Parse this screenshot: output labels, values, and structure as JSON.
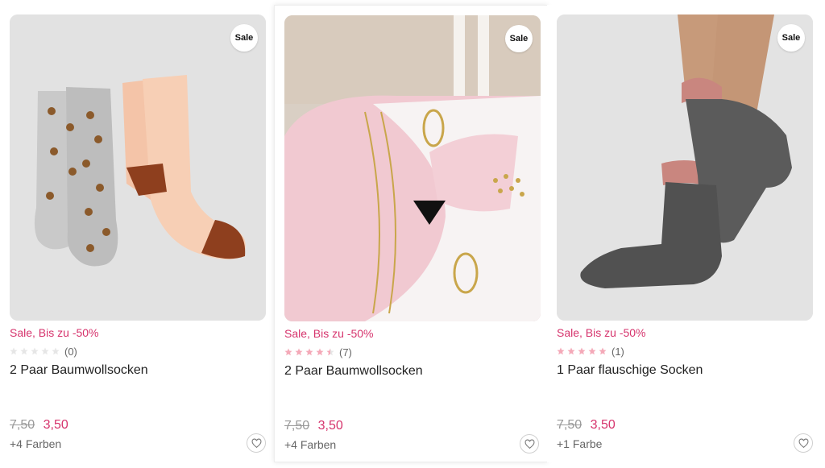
{
  "colors": {
    "accent": "#d6336c",
    "star_fill": "#f4a9b8",
    "star_empty": "#e6e6e6",
    "old_price": "#999999",
    "meta_text": "#666666"
  },
  "products": [
    {
      "sale_badge": "Sale",
      "promo": "Sale, Bis zu -50%",
      "rating": 0,
      "rating_count": "(0)",
      "title": "2 Paar Baumwollsocken",
      "old_price": "7,50",
      "new_price": "3,50",
      "colors": "+4 Farben",
      "wishlist_icon": "heart-icon"
    },
    {
      "sale_badge": "Sale",
      "promo": "Sale, Bis zu -50%",
      "rating": 4.5,
      "rating_count": "(7)",
      "title": "2 Paar Baumwollsocken",
      "old_price": "7,50",
      "new_price": "3,50",
      "colors": "+4 Farben",
      "wishlist_icon": "heart-icon"
    },
    {
      "sale_badge": "Sale",
      "promo": "Sale, Bis zu -50%",
      "rating": 5,
      "rating_count": "(1)",
      "title": "1 Paar flauschige Socken",
      "old_price": "7,50",
      "new_price": "3,50",
      "colors": "+1 Farbe",
      "wishlist_icon": "heart-icon"
    }
  ]
}
